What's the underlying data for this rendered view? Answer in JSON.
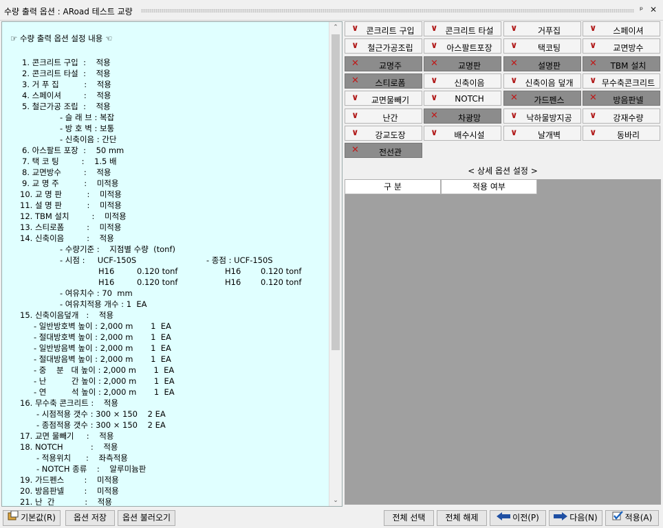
{
  "window": {
    "title": "수량 출력 옵션 : ARoad 테스트 교량",
    "pin_icon": "pin-icon",
    "close_icon": "close-icon"
  },
  "summary_lines": [
    "☞ 수량 출력 옵션 설정 내용 ☜",
    "1. 콘크리트 구입  :    적용",
    "2. 콘크리트 타설  :    적용",
    "3. 거 푸 집          :    적용",
    "4. 스페이셔         :    적용",
    "5. 철근가공 조립  :    적용",
    "- 슬 래 브 : 복잡",
    "- 방 호 벽 : 보통",
    "- 신축이음 : 간단",
    "6. 아스팔트 포장  :    50 mm",
    "7. 택 코 팅         :    1.5 배",
    "8. 교면방수         :    적용",
    "9. 교 명 주          :    미적용",
    "10. 교 명 판          :    미적용",
    "11. 설 명 판          :    미적용",
    "12. TBM 설치         :    미적용",
    "13. 스티로폼         :    미적용",
    "14. 신축이음         :    적용",
    "- 수량기준 :    지점별 수량  (tonf)",
    "- 시점 :     UCF-150S",
    "- 종점 : UCF-150S",
    "H16",
    "0.120 tonf",
    "H16",
    "0.120 tonf",
    "H16",
    "0.120 tonf",
    "H16",
    "0.120 tonf",
    "- 여유치수 : 70  mm",
    "- 여유치적용 개수 : 1  EA",
    "15. 신축이음덮개   :    적용",
    "- 일반방호벽 높이 : 2,000 m       1  EA",
    "- 절대방호벽 높이 : 2,000 m       1  EA",
    "- 일반방음벽 높이 : 2,000 m       1  EA",
    "- 절대방음벽 높이 : 2,000 m       1  EA",
    "- 중    분   대 높이 : 2,000 m       1  EA",
    "- 난          간 높이 : 2,000 m       1  EA",
    "- 연          석 높이 : 2,000 m       1  EA",
    "16. 무수축 콘크리트 :    적용",
    "- 시점적용 갯수 : 300 × 150    2 EA",
    "- 종점적용 갯수 : 300 × 150    2 EA",
    "17. 교면 물빼기     :    적용",
    "18. NOTCH           :    적용",
    "- 적용위치      :    좌측적용",
    "- NOTCH 종류    :    알루미늄판",
    "19. 가드펜스        :    미적용",
    "20. 방음판넬        :    미적용",
    "21. 난  간            :    적용"
  ],
  "options": [
    {
      "label": "콘크리트 구입",
      "on": true
    },
    {
      "label": "콘크리트 타설",
      "on": true
    },
    {
      "label": "거푸집",
      "on": true
    },
    {
      "label": "스페이셔",
      "on": true
    },
    {
      "label": "철근가공조립",
      "on": true
    },
    {
      "label": "아스팔트포장",
      "on": true
    },
    {
      "label": "택코팅",
      "on": true
    },
    {
      "label": "교면방수",
      "on": true
    },
    {
      "label": "교명주",
      "on": false
    },
    {
      "label": "교명판",
      "on": false
    },
    {
      "label": "설명판",
      "on": false
    },
    {
      "label": "TBM 설치",
      "on": false
    },
    {
      "label": "스티로폼",
      "on": false
    },
    {
      "label": "신축이음",
      "on": true
    },
    {
      "label": "신축이음 덮개",
      "on": true
    },
    {
      "label": "무수축콘크리트",
      "on": true
    },
    {
      "label": "교면물빼기",
      "on": true
    },
    {
      "label": "NOTCH",
      "on": true
    },
    {
      "label": "가드펜스",
      "on": false
    },
    {
      "label": "방음판넬",
      "on": false
    },
    {
      "label": "난간",
      "on": true
    },
    {
      "label": "차광망",
      "on": false
    },
    {
      "label": "낙하물방지공",
      "on": true
    },
    {
      "label": "강재수량",
      "on": true
    },
    {
      "label": "강교도장",
      "on": true
    },
    {
      "label": "배수시설",
      "on": true
    },
    {
      "label": "날개벽",
      "on": true
    },
    {
      "label": "동바리",
      "on": true
    },
    {
      "label": "전선관",
      "on": false
    }
  ],
  "check_mark": "∨",
  "cross_mark": "✕",
  "detail": {
    "title": "< 상세 옵션 설정 >",
    "col1": "구 분",
    "col2": "적용 여부"
  },
  "footer": {
    "default": "기본값(R)",
    "save": "옵션 저장",
    "load": "옵션 불러오기",
    "select_all": "전체 선택",
    "deselect_all": "전체 해제",
    "prev": "이전(P)",
    "next": "다음(N)",
    "apply": "적용(A)"
  },
  "colors": {
    "summary_bg": "#e0ffff",
    "option_off_bg": "#8c8c8c",
    "mark_red": "#b01818"
  }
}
